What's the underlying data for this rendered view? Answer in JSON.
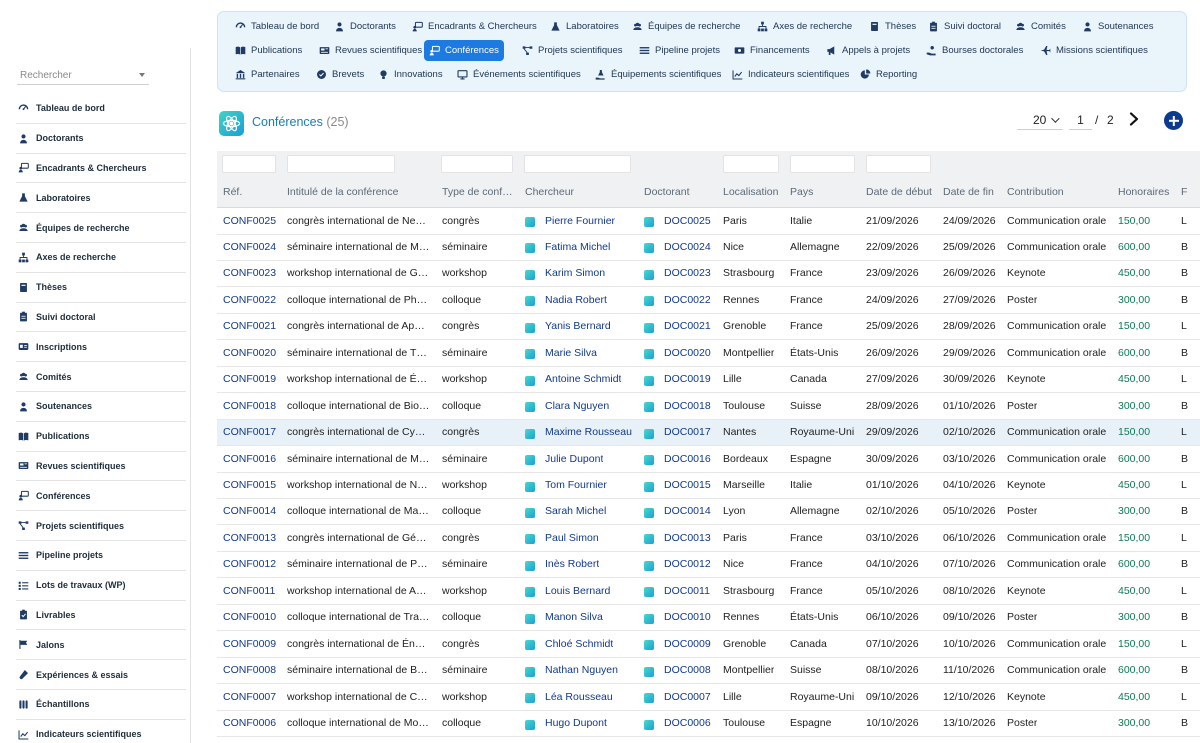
{
  "sidebar": {
    "search_placeholder": "Rechercher",
    "items": [
      {
        "label": "Tableau de bord",
        "icon": "dashboard-icon"
      },
      {
        "label": "Doctorants",
        "icon": "graduate-icon"
      },
      {
        "label": "Encadrants & Chercheurs",
        "icon": "teacher-icon"
      },
      {
        "label": "Laboratoires",
        "icon": "flask-icon"
      },
      {
        "label": "Équipes de recherche",
        "icon": "users-icon"
      },
      {
        "label": "Axes de recherche",
        "icon": "sitemap-icon"
      },
      {
        "label": "Thèses",
        "icon": "book-icon"
      },
      {
        "label": "Suivi doctoral",
        "icon": "clipboard-icon"
      },
      {
        "label": "Inscriptions",
        "icon": "id-card-icon"
      },
      {
        "label": "Comités",
        "icon": "users-icon"
      },
      {
        "label": "Soutenances",
        "icon": "graduate-icon"
      },
      {
        "label": "Publications",
        "icon": "open-book-icon"
      },
      {
        "label": "Revues scientifiques",
        "icon": "newspaper-icon"
      },
      {
        "label": "Conférences",
        "icon": "teacher-icon"
      },
      {
        "label": "Projets scientifiques",
        "icon": "project-diagram-icon"
      },
      {
        "label": "Pipeline projets",
        "icon": "list-icon"
      },
      {
        "label": "Lots de travaux (WP)",
        "icon": "tasks-icon"
      },
      {
        "label": "Livrables",
        "icon": "clipboard-check-icon"
      },
      {
        "label": "Jalons",
        "icon": "flag-icon"
      },
      {
        "label": "Expériences & essais",
        "icon": "vial-icon"
      },
      {
        "label": "Échantillons",
        "icon": "vials-icon"
      },
      {
        "label": "Indicateurs scientifiques",
        "icon": "chart-line-icon"
      }
    ]
  },
  "topnav": {
    "items": [
      {
        "label": "Tableau de bord",
        "icon": "dashboard-icon",
        "row": 0,
        "active": false
      },
      {
        "label": "Doctorants",
        "icon": "graduate-icon",
        "row": 0,
        "active": false
      },
      {
        "label": "Encadrants & Chercheurs",
        "icon": "teacher-icon",
        "row": 0,
        "active": false
      },
      {
        "label": "Laboratoires",
        "icon": "flask-icon",
        "row": 0,
        "active": false
      },
      {
        "label": "Équipes de recherche",
        "icon": "users-icon",
        "row": 0,
        "active": false
      },
      {
        "label": "Axes de recherche",
        "icon": "sitemap-icon",
        "row": 0,
        "active": false
      },
      {
        "label": "Thèses",
        "icon": "book-icon",
        "row": 0,
        "active": false
      },
      {
        "label": "Suivi doctoral",
        "icon": "clipboard-icon",
        "row": 0,
        "active": false
      },
      {
        "label": "Comités",
        "icon": "users-icon",
        "row": 0,
        "active": false
      },
      {
        "label": "Soutenances",
        "icon": "graduate-icon",
        "row": 0,
        "active": false
      },
      {
        "label": "Publications",
        "icon": "open-book-icon",
        "row": 1,
        "active": false
      },
      {
        "label": "Revues scientifiques",
        "icon": "newspaper-icon",
        "row": 1,
        "active": false
      },
      {
        "label": "Conférences",
        "icon": "teacher-icon",
        "row": 1,
        "active": true
      },
      {
        "label": "Projets scientifiques",
        "icon": "project-diagram-icon",
        "row": 1,
        "active": false
      },
      {
        "label": "Pipeline projets",
        "icon": "list-icon",
        "row": 1,
        "active": false
      },
      {
        "label": "Financements",
        "icon": "money-icon",
        "row": 1,
        "active": false
      },
      {
        "label": "Appels à projets",
        "icon": "bullhorn-icon",
        "row": 1,
        "active": false
      },
      {
        "label": "Bourses doctorales",
        "icon": "hand-coin-icon",
        "row": 1,
        "active": false
      },
      {
        "label": "Missions scientifiques",
        "icon": "plane-icon",
        "row": 1,
        "active": false
      },
      {
        "label": "Partenaires",
        "icon": "building-icon",
        "row": 2,
        "active": false
      },
      {
        "label": "Brevets",
        "icon": "certificate-icon",
        "row": 2,
        "active": false
      },
      {
        "label": "Innovations",
        "icon": "lightbulb-icon",
        "row": 2,
        "active": false
      },
      {
        "label": "Événements scientifiques",
        "icon": "screen-icon",
        "row": 2,
        "active": false
      },
      {
        "label": "Équipements scientifiques",
        "icon": "hand-flask-icon",
        "row": 2,
        "active": false
      },
      {
        "label": "Indicateurs scientifiques",
        "icon": "chart-line-icon",
        "row": 2,
        "active": false
      },
      {
        "label": "Reporting",
        "icon": "pie-chart-icon",
        "row": 2,
        "active": false
      }
    ]
  },
  "page": {
    "title": "Conférences",
    "count": "(25)",
    "page_size": "20",
    "page_current": "1",
    "page_sep": "/",
    "page_total": "2"
  },
  "colors": {
    "accent": "#1c7ae0",
    "link": "#123a8a",
    "fee": "#0e7a57",
    "title": "#1b7db0",
    "add_button": "#0b3a8f"
  },
  "table": {
    "columns": [
      "Réf.",
      "Intitulé de la conférence",
      "Type de conf…",
      "Chercheur",
      "Doctorant",
      "Localisation",
      "Pays",
      "Date de début",
      "Date de fin",
      "Contribution",
      "Honoraires",
      "F"
    ],
    "rows": [
      {
        "ref": "CONF0025",
        "title": "congrès international de Ne…",
        "type": "congrès",
        "researcher": "Pierre Fournier",
        "doctorant": "DOC0025",
        "city": "Paris",
        "country": "Italie",
        "start": "21/09/2026",
        "end": "24/09/2026",
        "contribution": "Communication orale",
        "fee": "150,00",
        "f": "L"
      },
      {
        "ref": "CONF0024",
        "title": "séminaire international de M…",
        "type": "séminaire",
        "researcher": "Fatima Michel",
        "doctorant": "DOC0024",
        "city": "Nice",
        "country": "Allemagne",
        "start": "22/09/2026",
        "end": "25/09/2026",
        "contribution": "Communication orale",
        "fee": "600,00",
        "f": "B"
      },
      {
        "ref": "CONF0023",
        "title": "workshop international de G…",
        "type": "workshop",
        "researcher": "Karim Simon",
        "doctorant": "DOC0023",
        "city": "Strasbourg",
        "country": "France",
        "start": "23/09/2026",
        "end": "26/09/2026",
        "contribution": "Keynote",
        "fee": "450,00",
        "f": "B"
      },
      {
        "ref": "CONF0022",
        "title": "colloque international de Ph…",
        "type": "colloque",
        "researcher": "Nadia Robert",
        "doctorant": "DOC0022",
        "city": "Rennes",
        "country": "France",
        "start": "24/09/2026",
        "end": "27/09/2026",
        "contribution": "Poster",
        "fee": "300,00",
        "f": "B"
      },
      {
        "ref": "CONF0021",
        "title": "congrès international de Ap…",
        "type": "congrès",
        "researcher": "Yanis Bernard",
        "doctorant": "DOC0021",
        "city": "Grenoble",
        "country": "France",
        "start": "25/09/2026",
        "end": "28/09/2026",
        "contribution": "Communication orale",
        "fee": "150,00",
        "f": "L"
      },
      {
        "ref": "CONF0020",
        "title": "séminaire international de T…",
        "type": "séminaire",
        "researcher": "Marie Silva",
        "doctorant": "DOC0020",
        "city": "Montpellier",
        "country": "États-Unis",
        "start": "26/09/2026",
        "end": "29/09/2026",
        "contribution": "Communication orale",
        "fee": "600,00",
        "f": "B"
      },
      {
        "ref": "CONF0019",
        "title": "workshop international de É…",
        "type": "workshop",
        "researcher": "Antoine Schmidt",
        "doctorant": "DOC0019",
        "city": "Lille",
        "country": "Canada",
        "start": "27/09/2026",
        "end": "30/09/2026",
        "contribution": "Keynote",
        "fee": "450,00",
        "f": "L"
      },
      {
        "ref": "CONF0018",
        "title": "colloque international de Bio…",
        "type": "colloque",
        "researcher": "Clara Nguyen",
        "doctorant": "DOC0018",
        "city": "Toulouse",
        "country": "Suisse",
        "start": "28/09/2026",
        "end": "01/10/2026",
        "contribution": "Poster",
        "fee": "300,00",
        "f": "B"
      },
      {
        "ref": "CONF0017",
        "title": "congrès international de Cy…",
        "type": "congrès",
        "researcher": "Maxime Rousseau",
        "doctorant": "DOC0017",
        "city": "Nantes",
        "country": "Royaume-Uni",
        "start": "29/09/2026",
        "end": "02/10/2026",
        "contribution": "Communication orale",
        "fee": "150,00",
        "f": "L"
      },
      {
        "ref": "CONF0016",
        "title": "séminaire international de M…",
        "type": "séminaire",
        "researcher": "Julie Dupont",
        "doctorant": "DOC0016",
        "city": "Bordeaux",
        "country": "Espagne",
        "start": "30/09/2026",
        "end": "03/10/2026",
        "contribution": "Communication orale",
        "fee": "600,00",
        "f": "B"
      },
      {
        "ref": "CONF0015",
        "title": "workshop international de N…",
        "type": "workshop",
        "researcher": "Tom Fournier",
        "doctorant": "DOC0015",
        "city": "Marseille",
        "country": "Italie",
        "start": "01/10/2026",
        "end": "04/10/2026",
        "contribution": "Keynote",
        "fee": "450,00",
        "f": "L"
      },
      {
        "ref": "CONF0014",
        "title": "colloque international de Ma…",
        "type": "colloque",
        "researcher": "Sarah Michel",
        "doctorant": "DOC0014",
        "city": "Lyon",
        "country": "Allemagne",
        "start": "02/10/2026",
        "end": "05/10/2026",
        "contribution": "Poster",
        "fee": "300,00",
        "f": "B"
      },
      {
        "ref": "CONF0013",
        "title": "congrès international de Gé…",
        "type": "congrès",
        "researcher": "Paul Simon",
        "doctorant": "DOC0013",
        "city": "Paris",
        "country": "France",
        "start": "03/10/2026",
        "end": "06/10/2026",
        "contribution": "Communication orale",
        "fee": "150,00",
        "f": "L"
      },
      {
        "ref": "CONF0012",
        "title": "séminaire international de P…",
        "type": "séminaire",
        "researcher": "Inès Robert",
        "doctorant": "DOC0012",
        "city": "Nice",
        "country": "France",
        "start": "04/10/2026",
        "end": "07/10/2026",
        "contribution": "Communication orale",
        "fee": "600,00",
        "f": "B"
      },
      {
        "ref": "CONF0011",
        "title": "workshop international de A…",
        "type": "workshop",
        "researcher": "Louis Bernard",
        "doctorant": "DOC0011",
        "city": "Strasbourg",
        "country": "France",
        "start": "05/10/2026",
        "end": "08/10/2026",
        "contribution": "Keynote",
        "fee": "450,00",
        "f": "L"
      },
      {
        "ref": "CONF0010",
        "title": "colloque international de Tra…",
        "type": "colloque",
        "researcher": "Manon Silva",
        "doctorant": "DOC0010",
        "city": "Rennes",
        "country": "États-Unis",
        "start": "06/10/2026",
        "end": "09/10/2026",
        "contribution": "Poster",
        "fee": "300,00",
        "f": "B"
      },
      {
        "ref": "CONF0009",
        "title": "congrès international de Én…",
        "type": "congrès",
        "researcher": "Chloé Schmidt",
        "doctorant": "DOC0009",
        "city": "Grenoble",
        "country": "Canada",
        "start": "07/10/2026",
        "end": "10/10/2026",
        "contribution": "Communication orale",
        "fee": "150,00",
        "f": "L"
      },
      {
        "ref": "CONF0008",
        "title": "séminaire international de B…",
        "type": "séminaire",
        "researcher": "Nathan Nguyen",
        "doctorant": "DOC0008",
        "city": "Montpellier",
        "country": "Suisse",
        "start": "08/10/2026",
        "end": "11/10/2026",
        "contribution": "Communication orale",
        "fee": "600,00",
        "f": "B"
      },
      {
        "ref": "CONF0007",
        "title": "workshop international de C…",
        "type": "workshop",
        "researcher": "Léa Rousseau",
        "doctorant": "DOC0007",
        "city": "Lille",
        "country": "Royaume-Uni",
        "start": "09/10/2026",
        "end": "12/10/2026",
        "contribution": "Keynote",
        "fee": "450,00",
        "f": "L"
      },
      {
        "ref": "CONF0006",
        "title": "colloque international de Mo…",
        "type": "colloque",
        "researcher": "Hugo Dupont",
        "doctorant": "DOC0006",
        "city": "Toulouse",
        "country": "Espagne",
        "start": "10/10/2026",
        "end": "13/10/2026",
        "contribution": "Poster",
        "fee": "300,00",
        "f": "B"
      }
    ]
  }
}
